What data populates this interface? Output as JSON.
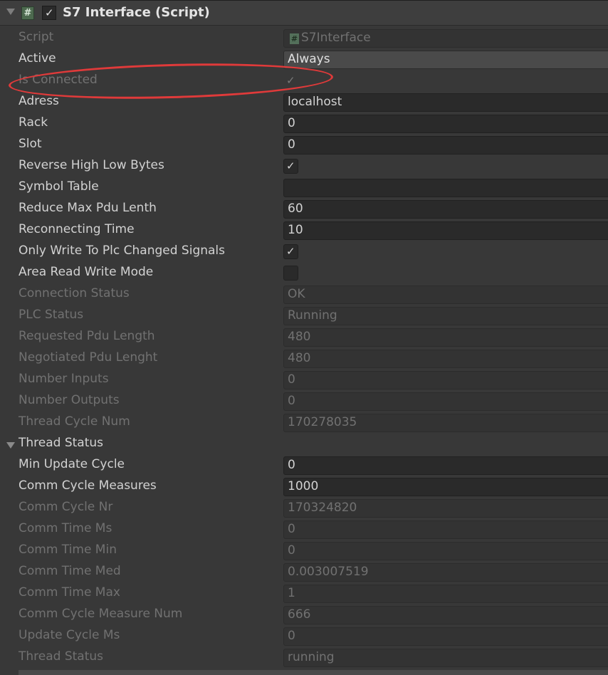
{
  "header": {
    "title": "S7 Interface (Script)",
    "script_icon_glyph": "#",
    "enabled_mark": "✓"
  },
  "rows": [
    {
      "label": "Script",
      "value": "S7Interface",
      "kind": "object",
      "disabled": true,
      "icon_glyph": "#"
    },
    {
      "label": "Active",
      "value": "Always",
      "kind": "dropdown",
      "disabled": false
    },
    {
      "label": "Is Connected",
      "value": "✓",
      "kind": "check",
      "disabled": true
    },
    {
      "label": "Adress",
      "value": "localhost",
      "kind": "text",
      "disabled": false
    },
    {
      "label": "Rack",
      "value": "0",
      "kind": "text",
      "disabled": false
    },
    {
      "label": "Slot",
      "value": "0",
      "kind": "text",
      "disabled": false
    },
    {
      "label": "Reverse High Low Bytes",
      "value": "✓",
      "kind": "check",
      "disabled": false
    },
    {
      "label": "Symbol Table",
      "value": "",
      "kind": "text",
      "disabled": false
    },
    {
      "label": "Reduce Max Pdu Lenth",
      "value": "60",
      "kind": "text",
      "disabled": false
    },
    {
      "label": "Reconnecting Time",
      "value": "10",
      "kind": "text",
      "disabled": false
    },
    {
      "label": "Only Write To Plc Changed Signals",
      "value": "✓",
      "kind": "check",
      "disabled": false
    },
    {
      "label": "Area Read Write Mode",
      "value": "",
      "kind": "check",
      "disabled": false
    },
    {
      "label": "Connection Status",
      "value": "OK",
      "kind": "text",
      "disabled": true
    },
    {
      "label": "PLC Status",
      "value": "Running",
      "kind": "text",
      "disabled": true
    },
    {
      "label": "Requested Pdu Length",
      "value": "480",
      "kind": "text",
      "disabled": true
    },
    {
      "label": "Negotiated Pdu Lenght",
      "value": "480",
      "kind": "text",
      "disabled": true
    },
    {
      "label": "Number Inputs",
      "value": "0",
      "kind": "text",
      "disabled": true
    },
    {
      "label": "Number Outputs",
      "value": "0",
      "kind": "text",
      "disabled": true
    },
    {
      "label": "Thread Cycle Num",
      "value": "170278035",
      "kind": "text",
      "disabled": true
    },
    {
      "label": "Thread Status",
      "value": "",
      "kind": "section",
      "disabled": false
    },
    {
      "label": "Min Update Cycle",
      "value": "0",
      "kind": "text",
      "disabled": false
    },
    {
      "label": "Comm Cycle Measures",
      "value": "1000",
      "kind": "text",
      "disabled": false
    },
    {
      "label": "Comm Cycle Nr",
      "value": "170324820",
      "kind": "text",
      "disabled": true
    },
    {
      "label": "Comm Time Ms",
      "value": "0",
      "kind": "text",
      "disabled": true
    },
    {
      "label": "Comm Time Min",
      "value": "0",
      "kind": "text",
      "disabled": true
    },
    {
      "label": "Comm Time Med",
      "value": "0.003007519",
      "kind": "text",
      "disabled": true
    },
    {
      "label": "Comm Time Max",
      "value": "1",
      "kind": "text",
      "disabled": true
    },
    {
      "label": "Comm Cycle Measure Num",
      "value": "666",
      "kind": "text",
      "disabled": true
    },
    {
      "label": "Update Cycle Ms",
      "value": "0",
      "kind": "text",
      "disabled": true
    },
    {
      "label": "Thread Status",
      "value": "running",
      "kind": "text",
      "disabled": true
    }
  ],
  "colors": {
    "background": "#383838",
    "highlight_ellipse": "#e03a3a"
  }
}
